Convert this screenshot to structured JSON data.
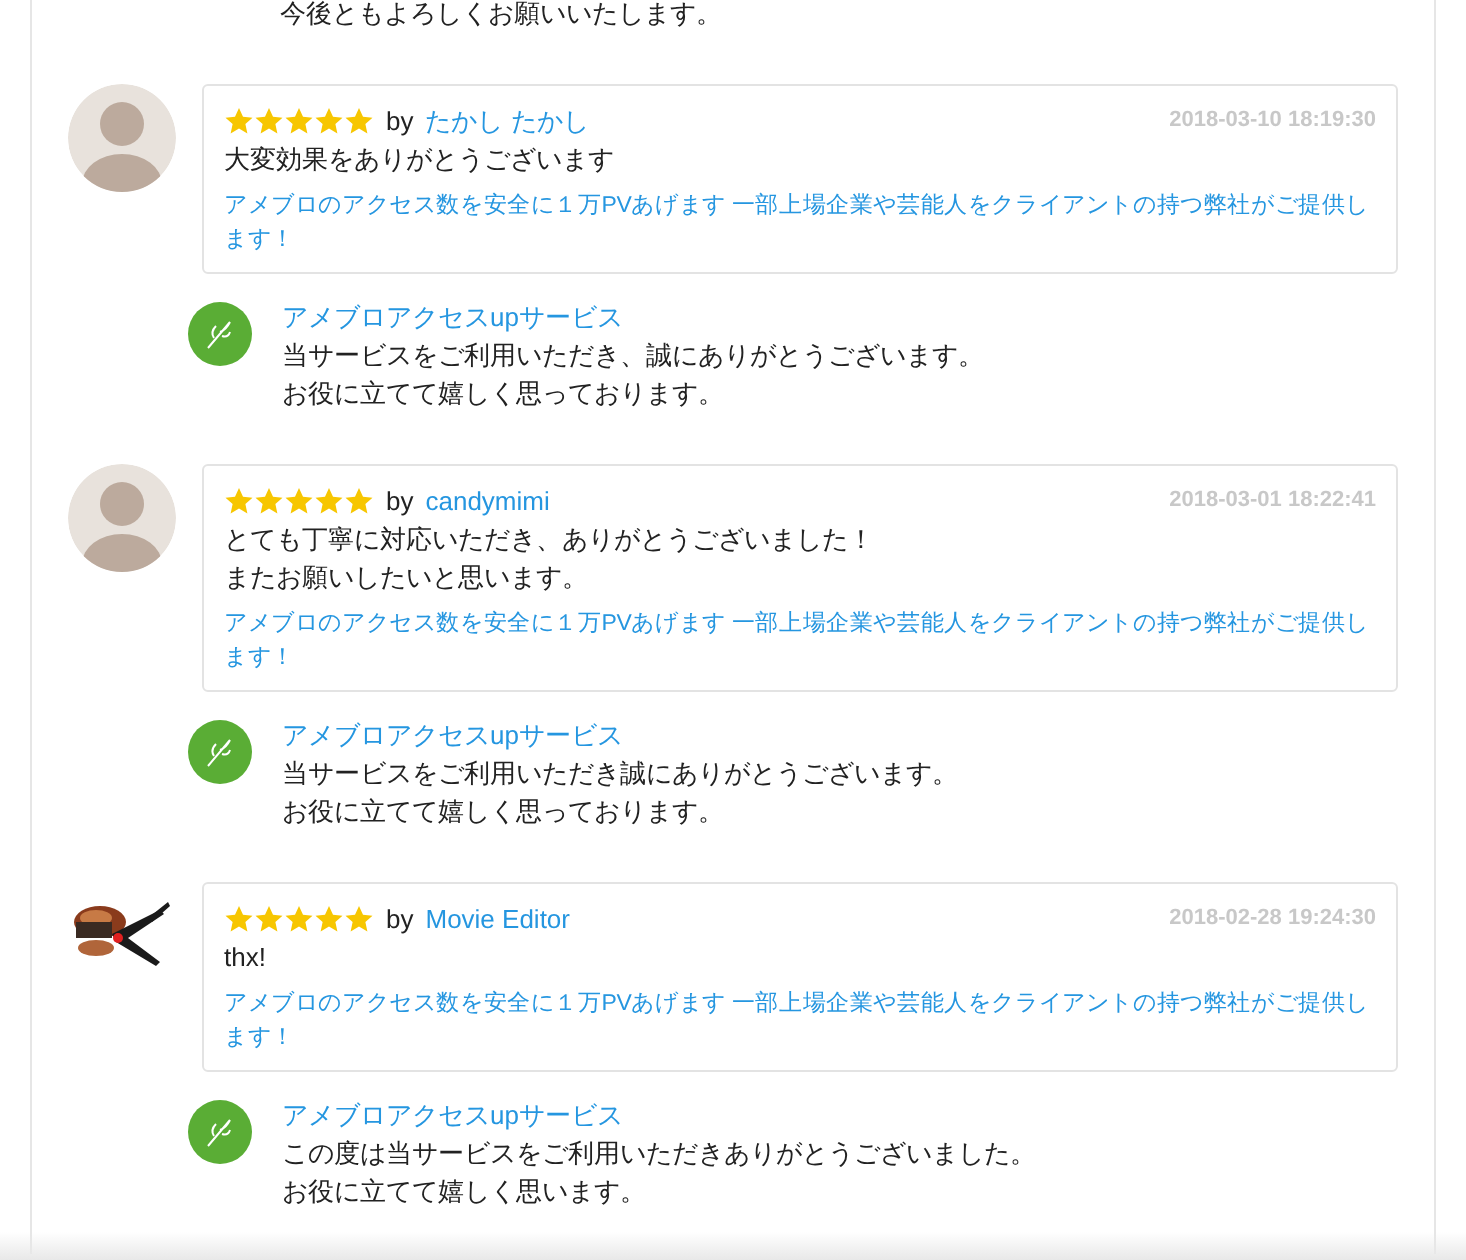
{
  "previous_reply": {
    "lines": [
      "今後ともよろしくお願いいたします。"
    ]
  },
  "reviews": [
    {
      "avatar": {
        "kind": "silhouette"
      },
      "stars": 5,
      "by": "by",
      "author": "たかし たかし",
      "date": "2018-03-10 18:19:30",
      "body": [
        "大変効果をありがとうございます"
      ],
      "service_link": "アメブロのアクセス数を安全に１万PVあげます 一部上場企業や芸能人をクライアントの持つ弊社がご提供します！",
      "reply": {
        "name": "アメブロアクセスupサービス",
        "lines": [
          "当サービスをご利用いただき、誠にありがとうございます。",
          "お役に立てて嬉しく思っております。"
        ]
      }
    },
    {
      "avatar": {
        "kind": "silhouette"
      },
      "stars": 5,
      "by": "by",
      "author": "candymimi",
      "date": "2018-03-01 18:22:41",
      "body": [
        "とても丁寧に対応いただき、ありがとうございました！",
        "またお願いしたいと思います。"
      ],
      "service_link": "アメブロのアクセス数を安全に１万PVあげます 一部上場企業や芸能人をクライアントの持つ弊社がご提供します！",
      "reply": {
        "name": "アメブロアクセスupサービス",
        "lines": [
          "当サービスをご利用いただき誠にありがとうございます。",
          "お役に立てて嬉しく思っております。"
        ]
      }
    },
    {
      "avatar": {
        "kind": "picture"
      },
      "stars": 5,
      "by": "by",
      "author": "Movie Editor",
      "date": "2018-02-28 19:24:30",
      "body": [
        "thx!"
      ],
      "service_link": "アメブロのアクセス数を安全に１万PVあげます 一部上場企業や芸能人をクライアントの持つ弊社がご提供します！",
      "reply": {
        "name": "アメブロアクセスupサービス",
        "lines": [
          "この度は当サービスをご利用いただきありがとうございました。",
          "お役に立てて嬉しく思います。"
        ]
      }
    }
  ]
}
